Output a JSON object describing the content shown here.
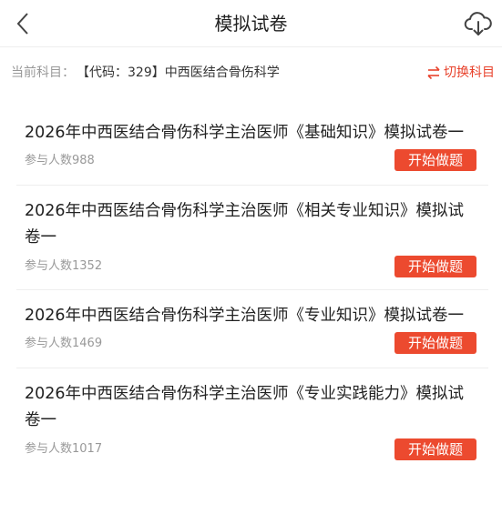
{
  "header": {
    "title": "模拟试卷",
    "back_icon": "chevron-left-icon",
    "download_icon": "cloud-download-icon"
  },
  "subject": {
    "label": "当前科目：",
    "name": "【代码：329】中西医结合骨伤科学",
    "switch_label": "切换科目",
    "switch_icon": "swap-arrows-icon"
  },
  "exams": [
    {
      "title": "2026年中西医结合骨伤科学主治医师《基础知识》模拟试卷一",
      "participants": "参与人数988",
      "button": "开始做题"
    },
    {
      "title": "2026年中西医结合骨伤科学主治医师《相关专业知识》模拟试卷一",
      "participants": "参与人数1352",
      "button": "开始做题"
    },
    {
      "title": "2026年中西医结合骨伤科学主治医师《专业知识》模拟试卷一",
      "participants": "参与人数1469",
      "button": "开始做题"
    },
    {
      "title": "2026年中西医结合骨伤科学主治医师《专业实践能力》模拟试卷一",
      "participants": "参与人数1017",
      "button": "开始做题"
    }
  ],
  "colors": {
    "accent": "#ec4a2f",
    "switch_text": "#e8422c",
    "muted_text": "#999999",
    "divider": "#eeeeee"
  }
}
